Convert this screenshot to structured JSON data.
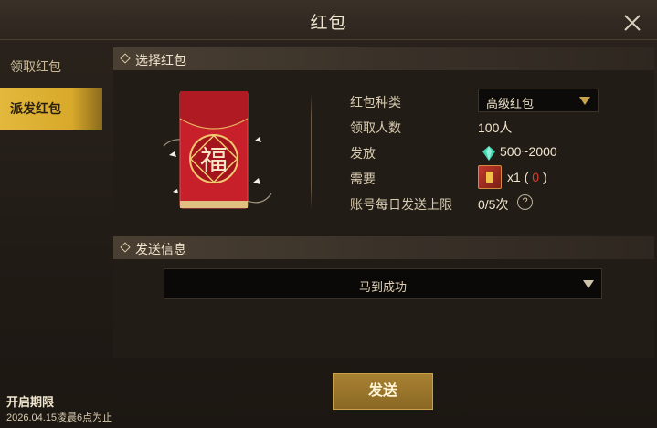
{
  "window": {
    "title": "红包"
  },
  "sidebar": {
    "items": [
      {
        "label": "领取红包",
        "active": false
      },
      {
        "label": "派发红包",
        "active": true
      }
    ]
  },
  "select_section": {
    "header": "选择红包",
    "envelope_char": "福",
    "fields": {
      "type_label": "红包种类",
      "type_value": "高级红包",
      "count_label": "领取人数",
      "count_value": "100人",
      "distribute_label": "发放",
      "distribute_value": "500~2000",
      "require_label": "需要",
      "require_qty": "x1",
      "require_owned_open": "(",
      "require_owned": "0",
      "require_owned_close": ")",
      "limit_label": "账号每日发送上限",
      "limit_value": "0/5次",
      "help_symbol": "?"
    }
  },
  "send_section": {
    "header": "发送信息",
    "message_value": "马到成功"
  },
  "footer": {
    "send_label": "发送",
    "period_title": "开启期限",
    "period_value": "2026.04.15凌晨6点为止"
  },
  "colors": {
    "accent_gold": "#d8a92a",
    "warning_red": "#e03a2a",
    "envelope_red": "#c8202a"
  },
  "icons": [
    "close-icon",
    "diamond-bullet-icon",
    "chevron-down-icon",
    "gem-icon",
    "red-envelope-item-icon",
    "help-icon"
  ]
}
